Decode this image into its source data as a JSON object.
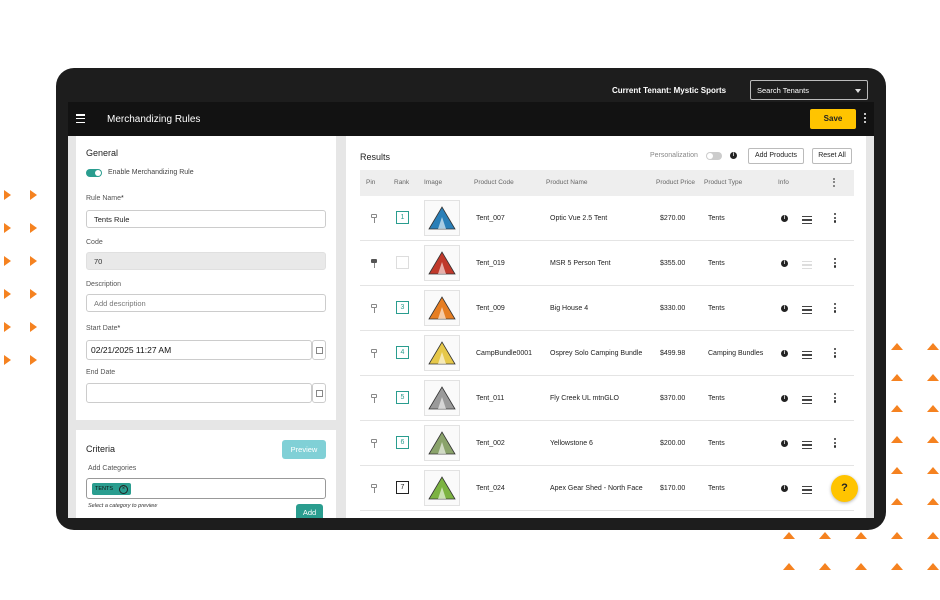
{
  "topbar": {
    "current_tenant": "Current Tenant: Mystic Sports",
    "search_tenants": "Search Tenants"
  },
  "appbar": {
    "title": "Merchandizing Rules",
    "save_label": "Save"
  },
  "general": {
    "title": "General",
    "enable_label": "Enable Merchandizing Rule",
    "enable_on": true,
    "rule_name_label": "Rule Name",
    "rule_name_value": "Tents Rule",
    "code_label": "Code",
    "code_value": "70",
    "description_label": "Description",
    "description_placeholder": "Add description",
    "start_date_label": "Start Date",
    "start_date_value": "02/21/2025 11:27 AM",
    "end_date_label": "End Date",
    "end_date_value": ""
  },
  "criteria": {
    "title": "Criteria",
    "preview_label": "Preview",
    "add_categories_label": "Add Categories",
    "chip_label": "TENTS",
    "hint": "Select a category to preview",
    "add_label": "Add"
  },
  "results": {
    "title": "Results",
    "personalization_label": "Personalization",
    "add_products_label": "Add Products",
    "reset_all_label": "Reset All",
    "columns": {
      "pin": "Pin",
      "rank": "Rank",
      "image": "Image",
      "code": "Product Code",
      "name": "Product Name",
      "price": "Product Price",
      "type": "Product Type",
      "info": "Info"
    },
    "rows": [
      {
        "rank": "1",
        "code": "Tent_007",
        "name": "Optic Vue 2.5 Tent",
        "price": "$270.00",
        "type": "Tents",
        "pinned": false,
        "color": "#2a7fb8"
      },
      {
        "rank": "",
        "code": "Tent_019",
        "name": "MSR 5 Person Tent",
        "price": "$355.00",
        "type": "Tents",
        "pinned": true,
        "color": "#c0392b"
      },
      {
        "rank": "3",
        "code": "Tent_009",
        "name": "Big House 4",
        "price": "$330.00",
        "type": "Tents",
        "pinned": false,
        "color": "#e67e22"
      },
      {
        "rank": "4",
        "code": "CampBundle0001",
        "name": "Osprey Solo Camping Bundle",
        "price": "$499.98",
        "type": "Camping Bundles",
        "pinned": false,
        "color": "#e6c84a"
      },
      {
        "rank": "5",
        "code": "Tent_011",
        "name": "Fly Creek UL mtnGLO",
        "price": "$370.00",
        "type": "Tents",
        "pinned": false,
        "color": "#9a9a9a"
      },
      {
        "rank": "6",
        "code": "Tent_002",
        "name": "Yellowstone 6",
        "price": "$200.00",
        "type": "Tents",
        "pinned": false,
        "color": "#8aa36b"
      },
      {
        "rank": "7",
        "code": "Tent_024",
        "name": "Apex Gear Shed - North Face",
        "price": "$170.00",
        "type": "Tents",
        "pinned": false,
        "color": "#7cb342"
      }
    ]
  },
  "help_label": "?",
  "colors": {
    "accent": "#2a9d8f",
    "save": "#ffc400",
    "decor": "#f58220"
  }
}
